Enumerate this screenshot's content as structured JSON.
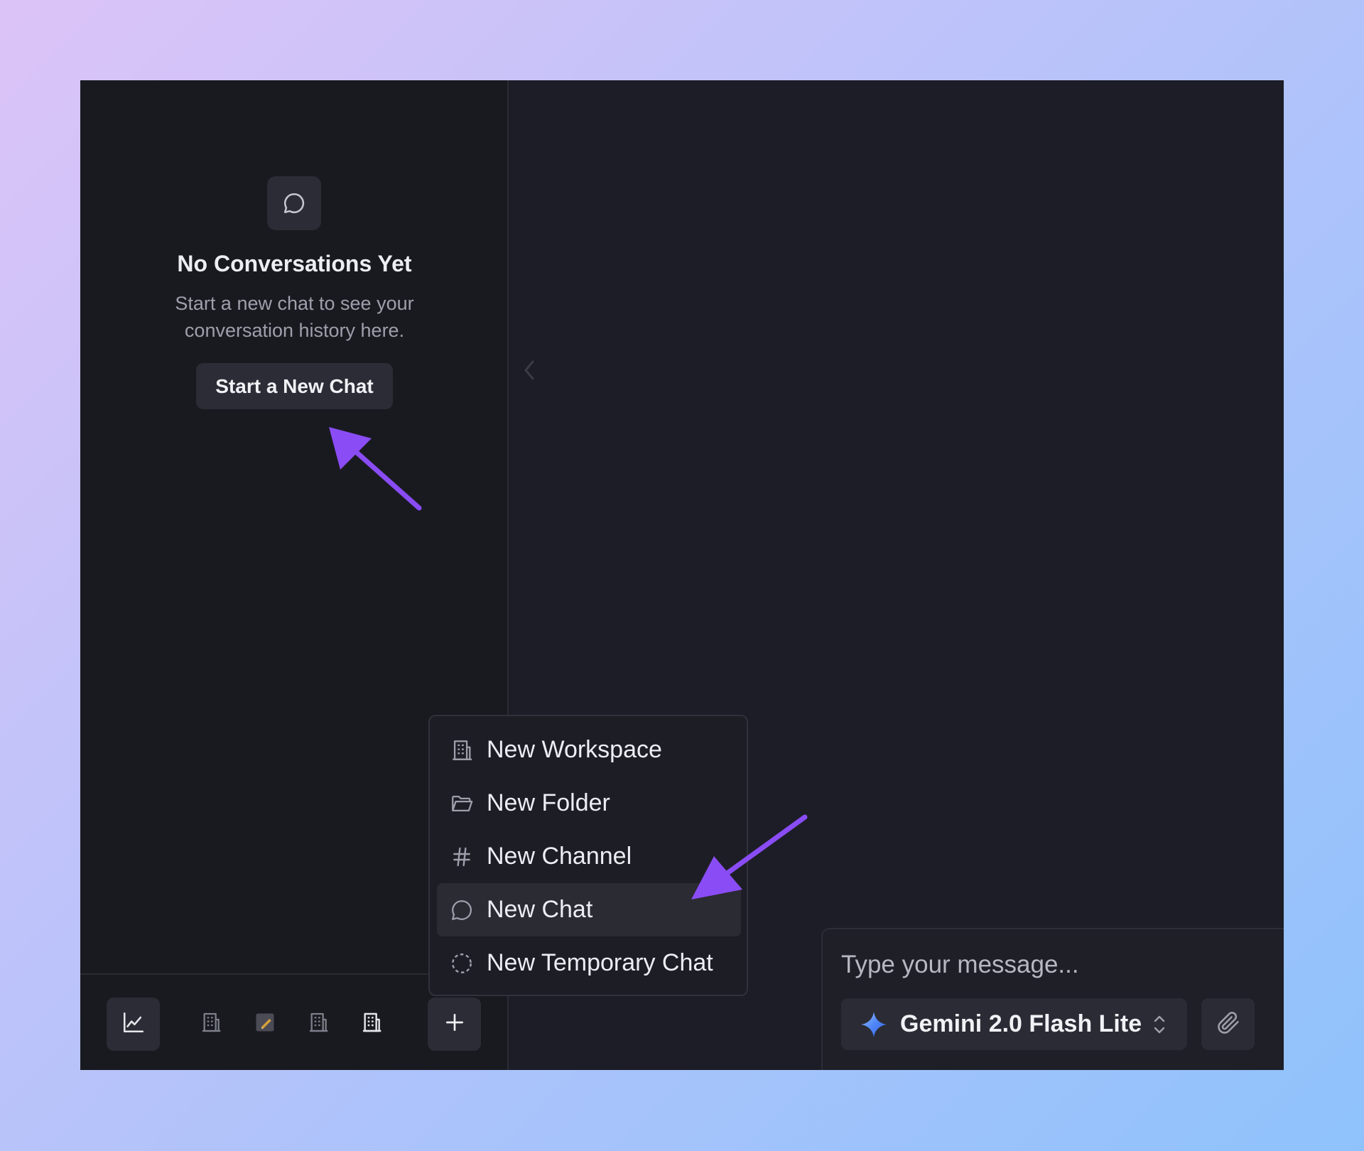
{
  "sidebar": {
    "empty_state": {
      "icon": "chat-bubble-icon",
      "title": "No Conversations Yet",
      "description": "Start a new chat to see your conversation history here.",
      "button_label": "Start a New Chat"
    },
    "footer": {
      "buttons": [
        {
          "icon": "chart-icon",
          "active": true
        },
        {
          "icon": "building-icon"
        },
        {
          "icon": "notepad-icon"
        },
        {
          "icon": "building-icon"
        },
        {
          "icon": "building-icon"
        },
        {
          "icon": "plus-icon"
        }
      ]
    }
  },
  "new_menu": {
    "items": [
      {
        "icon": "building-icon",
        "label": "New Workspace"
      },
      {
        "icon": "folder-icon",
        "label": "New Folder"
      },
      {
        "icon": "hash-icon",
        "label": "New Channel"
      },
      {
        "icon": "chat-bubble-icon",
        "label": "New Chat",
        "highlighted": true
      },
      {
        "icon": "dashed-circle-icon",
        "label": "New Temporary Chat"
      }
    ]
  },
  "composer": {
    "placeholder": "Type your message...",
    "model": {
      "icon": "gemini-sparkle-icon",
      "label": "Gemini 2.0 Flash Lite"
    },
    "attach_icon": "paperclip-icon"
  },
  "annotation_color": "#8a4cf5"
}
